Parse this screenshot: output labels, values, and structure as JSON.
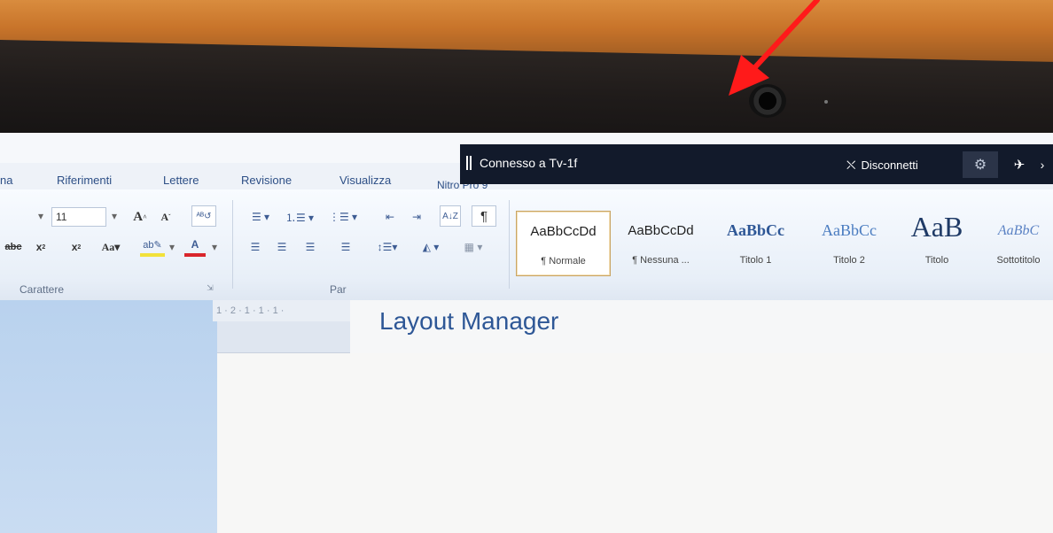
{
  "ribbon_tabs": [
    "na",
    "Riferimenti",
    "Lettere",
    "Revisione",
    "Visualizza",
    "Nitro Pro 9"
  ],
  "banner": {
    "title": "Connesso a Tv-1f",
    "disconnect_label": "Disconnetti"
  },
  "ribbon": {
    "font_size": "11",
    "groups": {
      "font": "Carattere",
      "paragraph": "Par"
    },
    "styles": [
      {
        "sample": "AaBbCcDd",
        "name": "¶ Normale"
      },
      {
        "sample": "AaBbCcDd",
        "name": "¶ Nessuna ..."
      },
      {
        "sample": "AaBbCc",
        "name": "Titolo 1"
      },
      {
        "sample": "AaBbCc",
        "name": "Titolo 2"
      },
      {
        "sample": "AaB",
        "name": "Titolo"
      },
      {
        "sample": "AaBbC",
        "name": "Sottotitolo"
      }
    ]
  },
  "ruler_text": "1 · 2 · 1 · 1 · 1 ·",
  "document": {
    "heading": "Layout Manager"
  },
  "colors": {
    "banner_bg": "#121a2b",
    "heading": "#2e5796",
    "arrow": "#ff1a1a",
    "tab_text": "#2d4f86"
  }
}
